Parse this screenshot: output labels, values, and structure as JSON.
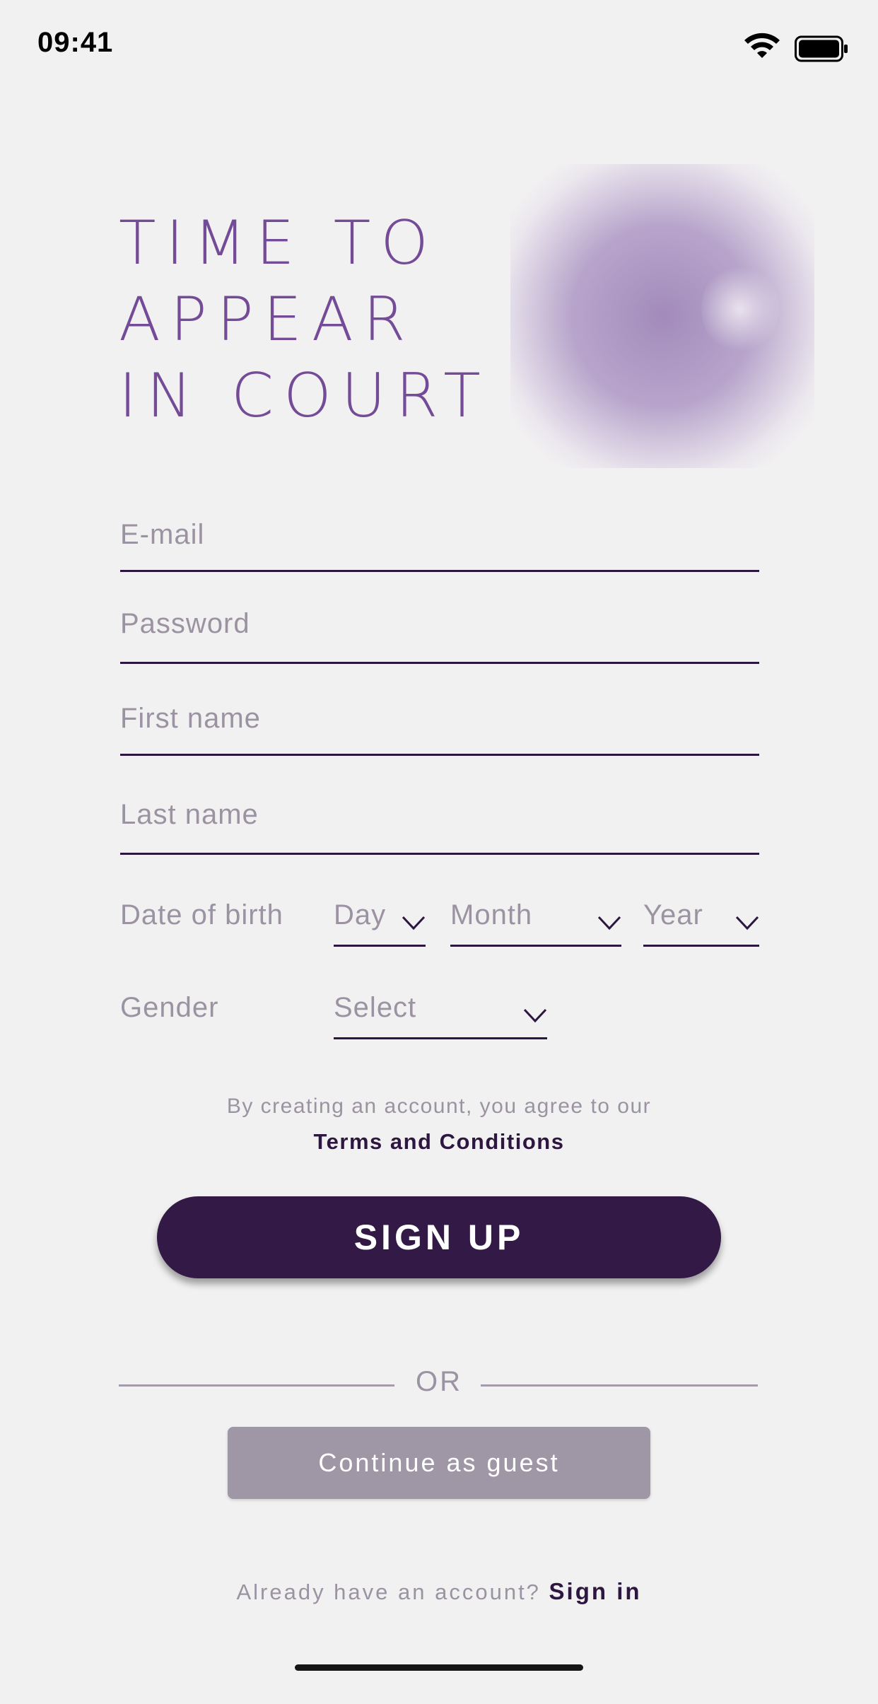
{
  "status_bar": {
    "time": "09:41"
  },
  "hero": {
    "title_lines": [
      "TIME TO",
      "APPEAR",
      "IN COURT"
    ]
  },
  "form": {
    "email_placeholder": "E-mail",
    "password_placeholder": "Password",
    "first_name_placeholder": "First name",
    "last_name_placeholder": "Last name",
    "dob_label": "Date of birth",
    "day_placeholder": "Day",
    "month_placeholder": "Month",
    "year_placeholder": "Year",
    "gender_label": "Gender",
    "gender_placeholder": "Select"
  },
  "terms": {
    "text": "By creating an account, you agree to our",
    "link": "Terms and Conditions"
  },
  "actions": {
    "signup_label": "SIGN UP",
    "or_label": "OR",
    "guest_label": "Continue as guest",
    "signin_prompt": "Already have an account?",
    "signin_link": "Sign in"
  },
  "colors": {
    "accent": "#734b96",
    "primary_dark": "#331946",
    "muted_text": "#9b93a2",
    "guest_button": "#a097a6",
    "background": "#f2f1f1"
  }
}
